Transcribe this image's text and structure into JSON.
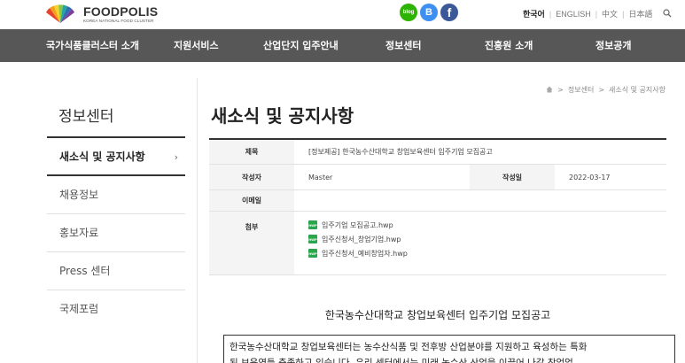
{
  "header": {
    "logo": {
      "name": "FOODPOLIS",
      "subtitle": "KOREA NATIONAL FOOD CLUSTER"
    },
    "social": [
      {
        "icon": "blog-icon",
        "label": "blog",
        "color": "#2db400"
      },
      {
        "icon": "band-icon",
        "label": "B",
        "color": "#3d8ff1"
      },
      {
        "icon": "facebook-icon",
        "label": "f",
        "color": "#3b5998"
      }
    ],
    "languages": [
      "한국어",
      "ENGLISH",
      "中文",
      "日本語"
    ],
    "active_language": "한국어",
    "search_icon": "search-icon"
  },
  "gnb": [
    "국가식품클러스터 소개",
    "지원서비스",
    "산업단지 입주안내",
    "정보센터",
    "진흥원 소개",
    "정보공개"
  ],
  "sidebar": {
    "title": "정보센터",
    "items": [
      {
        "label": "새소식 및 공지사항",
        "active": true,
        "chevron": "›"
      },
      {
        "label": "채용정보"
      },
      {
        "label": "홍보자료"
      },
      {
        "label": "Press 센터"
      },
      {
        "label": "국제포럼"
      }
    ]
  },
  "breadcrumb": {
    "home_icon": "home-icon",
    "sep": ">",
    "items": [
      "정보센터",
      "새소식 및 공지사항"
    ]
  },
  "page_title": "새소식 및 공지사항",
  "post": {
    "subject_label": "제목",
    "subject": "[정보제공] 한국농수산대학교 창업보육센터 입주기업 모집공고",
    "author_label": "작성자",
    "author": "Master",
    "date_label": "작성일",
    "date": "2022-03-17",
    "email_label": "이메일",
    "email": "",
    "attach_label": "첨부",
    "attachments": [
      {
        "icon": "HWP",
        "name": "입주기업 모집공고.hwp"
      },
      {
        "icon": "HWP",
        "name": "입주신청서_창업기업.hwp"
      },
      {
        "icon": "HWP",
        "name": "입주신청서_예비창업자.hwp"
      }
    ]
  },
  "document": {
    "title": "한국농수산대학교 창업보육센터 입주기업 모집공고",
    "body_line1": "한국농수산대학교 창업보육센터는 농수산식품 및 전후방 산업분야를 지원하고 육성하는 특화",
    "body_line2": "된 보육역들 충족하고 있습니다. 우리 센터에서는 미래 농수산 산업을 이끌어 나갈 창업업"
  }
}
